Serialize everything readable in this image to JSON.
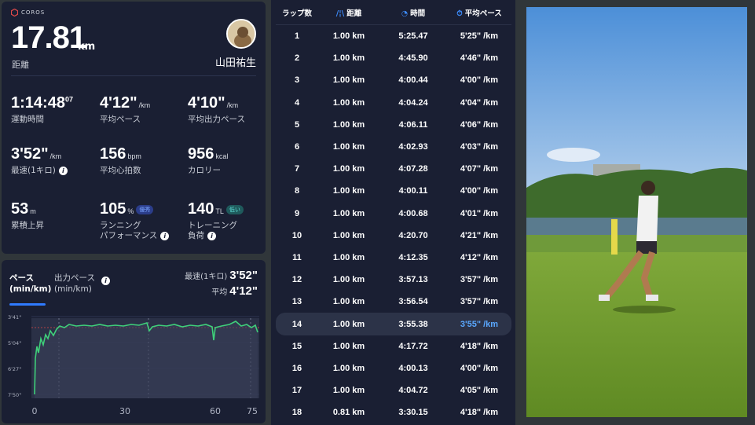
{
  "summary": {
    "brand": "COROS",
    "distance": "17.81",
    "distance_unit": "km",
    "distance_label": "距離",
    "user_name": "山田祐生",
    "stats": [
      {
        "value": "1:14:48",
        "sub": "07",
        "unit": "",
        "label": "運動時間"
      },
      {
        "value": "4'12\"",
        "unit": "/km",
        "label": "平均ペース"
      },
      {
        "value": "4'10\"",
        "unit": "/km",
        "label": "平均出力ペース"
      },
      {
        "value": "3'52\"",
        "unit": "/km",
        "label": "最速(1キロ)"
      },
      {
        "value": "156",
        "unit": "bpm",
        "label": "平均心拍数"
      },
      {
        "value": "956",
        "unit": "kcal",
        "label": "カロリー"
      },
      {
        "value": "53",
        "unit": "m",
        "label": "累積上昇"
      },
      {
        "value": "105",
        "unit": "%",
        "badge": "優秀",
        "label": "ランニング\nパフォーマンス"
      },
      {
        "value": "140",
        "unit": "TL",
        "badge": "低い",
        "label": "トレーニング\n負荷"
      }
    ]
  },
  "chart": {
    "tab_pace": "ペース\n(min/km)",
    "tab_power": "出力ペース\n(min/km)",
    "fastest_label": "最速(1キロ)",
    "fastest_value": "3'52\"",
    "avg_label": "平均",
    "avg_value": "4'12\"",
    "y_ticks": [
      "3'41\"",
      "5'04\"",
      "6'27\"",
      "7'50\""
    ],
    "x_ticks": [
      "0",
      "30",
      "60",
      "75"
    ]
  },
  "laps": {
    "headers": [
      "ラップ数",
      "距離",
      "時間",
      "平均ペース"
    ],
    "rows": [
      [
        "1",
        "1.00 km",
        "5:25.47",
        "5'25\" /km"
      ],
      [
        "2",
        "1.00 km",
        "4:45.90",
        "4'46\" /km"
      ],
      [
        "3",
        "1.00 km",
        "4:00.44",
        "4'00\" /km"
      ],
      [
        "4",
        "1.00 km",
        "4:04.24",
        "4'04\" /km"
      ],
      [
        "5",
        "1.00 km",
        "4:06.11",
        "4'06\" /km"
      ],
      [
        "6",
        "1.00 km",
        "4:02.93",
        "4'03\" /km"
      ],
      [
        "7",
        "1.00 km",
        "4:07.28",
        "4'07\" /km"
      ],
      [
        "8",
        "1.00 km",
        "4:00.11",
        "4'00\" /km"
      ],
      [
        "9",
        "1.00 km",
        "4:00.68",
        "4'01\" /km"
      ],
      [
        "10",
        "1.00 km",
        "4:20.70",
        "4'21\" /km"
      ],
      [
        "11",
        "1.00 km",
        "4:12.35",
        "4'12\" /km"
      ],
      [
        "12",
        "1.00 km",
        "3:57.13",
        "3'57\" /km"
      ],
      [
        "13",
        "1.00 km",
        "3:56.54",
        "3'57\" /km"
      ],
      [
        "14",
        "1.00 km",
        "3:55.38",
        "3'55\" /km"
      ],
      [
        "15",
        "1.00 km",
        "4:17.72",
        "4'18\" /km"
      ],
      [
        "16",
        "1.00 km",
        "4:00.13",
        "4'00\" /km"
      ],
      [
        "17",
        "1.00 km",
        "4:04.72",
        "4'05\" /km"
      ],
      [
        "18",
        "0.81 km",
        "3:30.15",
        "4'18\" /km"
      ]
    ],
    "highlight_row": 13
  },
  "colors": {
    "panel": "#1a1f33",
    "accent": "#2f7bff",
    "line": "#3fd07a",
    "highlight_text": "#5aa8ff"
  }
}
